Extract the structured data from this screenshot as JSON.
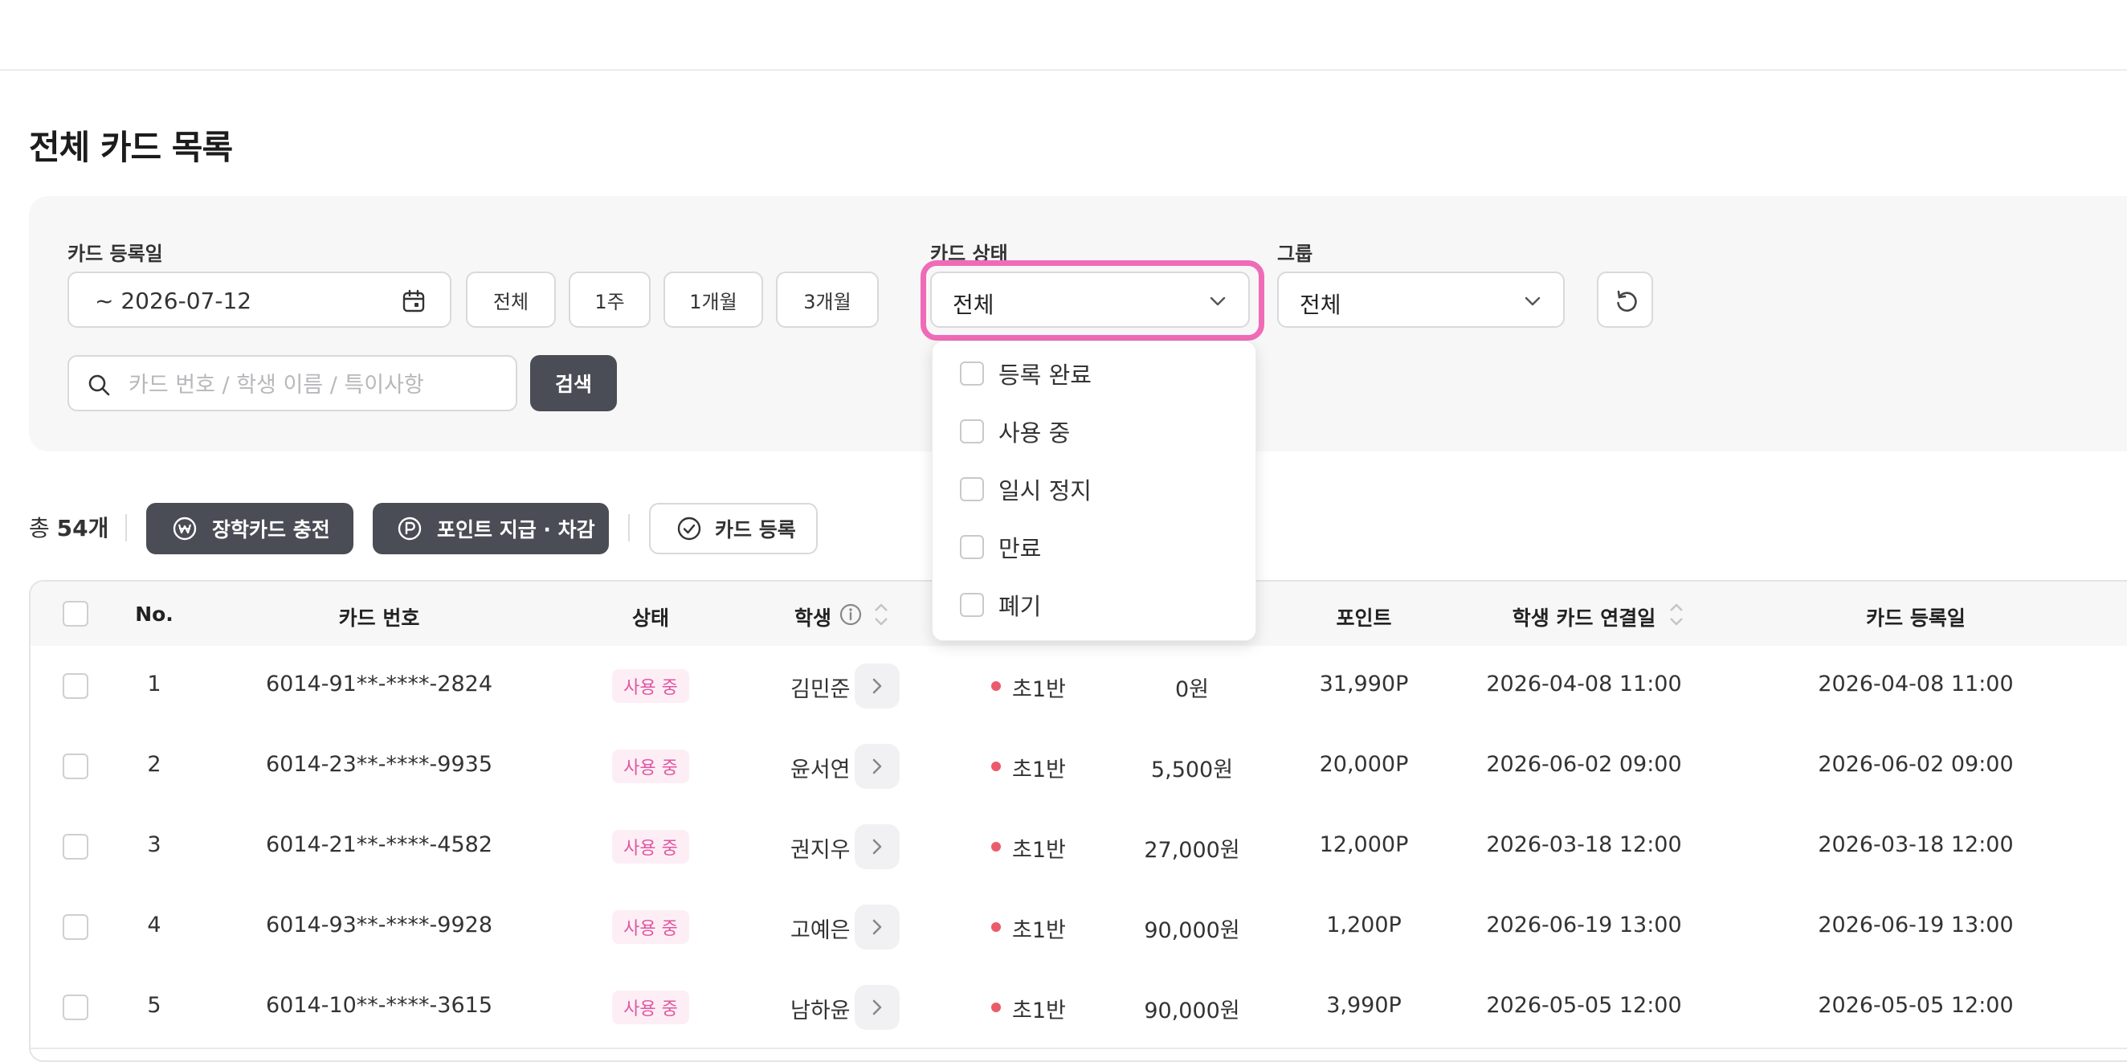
{
  "page": {
    "title": "전체 카드 목록"
  },
  "filters": {
    "reg_date_label": "카드 등록일",
    "reg_date_value": "~ 2026-07-12",
    "period_chips": [
      "전체",
      "1주",
      "1개월",
      "3개월"
    ],
    "status_label": "카드 상태",
    "status_value": "전체",
    "group_label": "그룹",
    "group_value": "전체",
    "search_placeholder": "카드 번호 / 학생 이름 / 특이사항",
    "search_button": "검색"
  },
  "status_dropdown": {
    "options": [
      "등록 완료",
      "사용 중",
      "일시 정지",
      "만료",
      "폐기"
    ]
  },
  "toolbar": {
    "total_prefix": "총 ",
    "total_count": "54개",
    "charge_button": "장학카드 충전",
    "point_button": "포인트 지급 · 차감",
    "register_button": "카드 등록"
  },
  "table": {
    "headers": {
      "no": "No.",
      "card_number": "카드 번호",
      "status": "상태",
      "student": "학생",
      "point": "포인트",
      "linked_date": "학생 카드 연결일",
      "reg_date": "카드 등록일"
    },
    "rows": [
      {
        "no": "1",
        "card": "6014-91**-****-2824",
        "status": "사용 중",
        "student": "김민준",
        "group": "초1반",
        "balance": "0원",
        "point": "31,990P",
        "linked": "2026-04-08 11:00",
        "registered": "2026-04-08 11:00"
      },
      {
        "no": "2",
        "card": "6014-23**-****-9935",
        "status": "사용 중",
        "student": "윤서연",
        "group": "초1반",
        "balance": "5,500원",
        "point": "20,000P",
        "linked": "2026-06-02 09:00",
        "registered": "2026-06-02 09:00"
      },
      {
        "no": "3",
        "card": "6014-21**-****-4582",
        "status": "사용 중",
        "student": "권지우",
        "group": "초1반",
        "balance": "27,000원",
        "point": "12,000P",
        "linked": "2026-03-18 12:00",
        "registered": "2026-03-18 12:00"
      },
      {
        "no": "4",
        "card": "6014-93**-****-9928",
        "status": "사용 중",
        "student": "고예은",
        "group": "초1반",
        "balance": "90,000원",
        "point": "1,200P",
        "linked": "2026-06-19 13:00",
        "registered": "2026-06-19 13:00"
      },
      {
        "no": "5",
        "card": "6014-10**-****-3615",
        "status": "사용 중",
        "student": "남하윤",
        "group": "초1반",
        "balance": "90,000원",
        "point": "3,990P",
        "linked": "2026-05-05 12:00",
        "registered": "2026-05-05 12:00"
      }
    ]
  }
}
